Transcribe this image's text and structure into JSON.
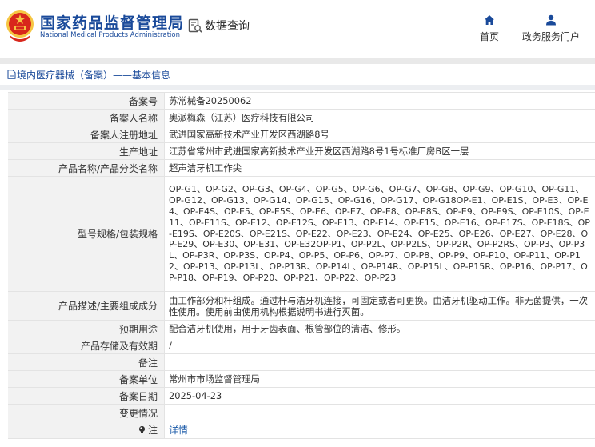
{
  "header": {
    "brand_cn": "国家药品监督管理局",
    "brand_en": "National Medical Products Administration",
    "data_query_label": "数据查询",
    "nav_home_label": "首页",
    "nav_gov_label": "政务服务门户"
  },
  "breadcrumb": {
    "text": "境内医疗器械（备案）——基本信息"
  },
  "record": [
    {
      "label": "备案号",
      "value": "苏常械备20250062"
    },
    {
      "label": "备案人名称",
      "value": "奥派梅森（江苏）医疗科技有限公司"
    },
    {
      "label": "备案人注册地址",
      "value": "武进国家高新技术产业开发区西湖路8号"
    },
    {
      "label": "生产地址",
      "value": "江苏省常州市武进国家高新技术产业开发区西湖路8号1号标准厂房B区一层"
    },
    {
      "label": "产品名称/产品分类名称",
      "value": "超声洁牙机工作尖"
    },
    {
      "label": "型号规格/包装规格",
      "value": "OP-G1、OP-G2、OP-G3、OP-G4、OP-G5、OP-G6、OP-G7、OP-G8、OP-G9、OP-G10、OP-G11、OP-G12、OP-G13、OP-G14、OP-G15、OP-G16、OP-G17、OP-G18OP-E1、OP-E1S、OP-E3、OP-E4、OP-E4S、OP-E5、OP-E5S、OP-E6、OP-E7、OP-E8、OP-E8S、OP-E9、OP-E9S、OP-E10S、OP-E11、OP-E11S、OP-E12、OP-E12S、OP-E13、OP-E14、OP-E15、OP-E16、OP-E17S、OP-E18S、OP-E19S、OP-E20S、OP-E21S、OP-E22、OP-E23、OP-E24、OP-E25、OP-E26、OP-E27、OP-E28、OP-E29、OP-E30、OP-E31、OP-E32OP-P1、OP-P2L、OP-P2LS、OP-P2R、OP-P2RS、OP-P3、OP-P3L、OP-P3R、OP-P3S、OP-P4、OP-P5、OP-P6、OP-P7、OP-P8、OP-P9、OP-P10、OP-P11、OP-P12、OP-P13、OP-P13L、OP-P13R、OP-P14L、OP-P14R、OP-P15L、OP-P15R、OP-P16、OP-P17、OP-P18、OP-P19、OP-P20、OP-P21、OP-P22、OP-P23"
    },
    {
      "label": "产品描述/主要组成成分",
      "value": "由工作部分和杆组成。通过杆与洁牙机连接，可固定或者可更换。由洁牙机驱动工作。非无菌提供，一次性使用。使用前由使用机构根据说明书进行灭菌。"
    },
    {
      "label": "预期用途",
      "value": "配合洁牙机使用，用于牙齿表面、根管部位的清洁、修形。"
    },
    {
      "label": "产品存储及有效期",
      "value": "/"
    },
    {
      "label": "备注",
      "value": ""
    },
    {
      "label": "备案单位",
      "value": "常州市市场监督管理局"
    },
    {
      "label": "备案日期",
      "value": "2025-04-23"
    },
    {
      "label": "变更情况",
      "value": ""
    }
  ],
  "note": {
    "label": "注",
    "link_text": "详情"
  },
  "icons": {
    "logo": "national-emblem-icon",
    "data_query": "document-search-icon",
    "home": "home-icon",
    "gov": "user-icon",
    "breadcrumb": "document-icon",
    "note": "bulb-icon"
  },
  "colors": {
    "brand": "#1a4a9a",
    "label_bg": "#f2f2f2",
    "link": "#1a5aa8"
  }
}
